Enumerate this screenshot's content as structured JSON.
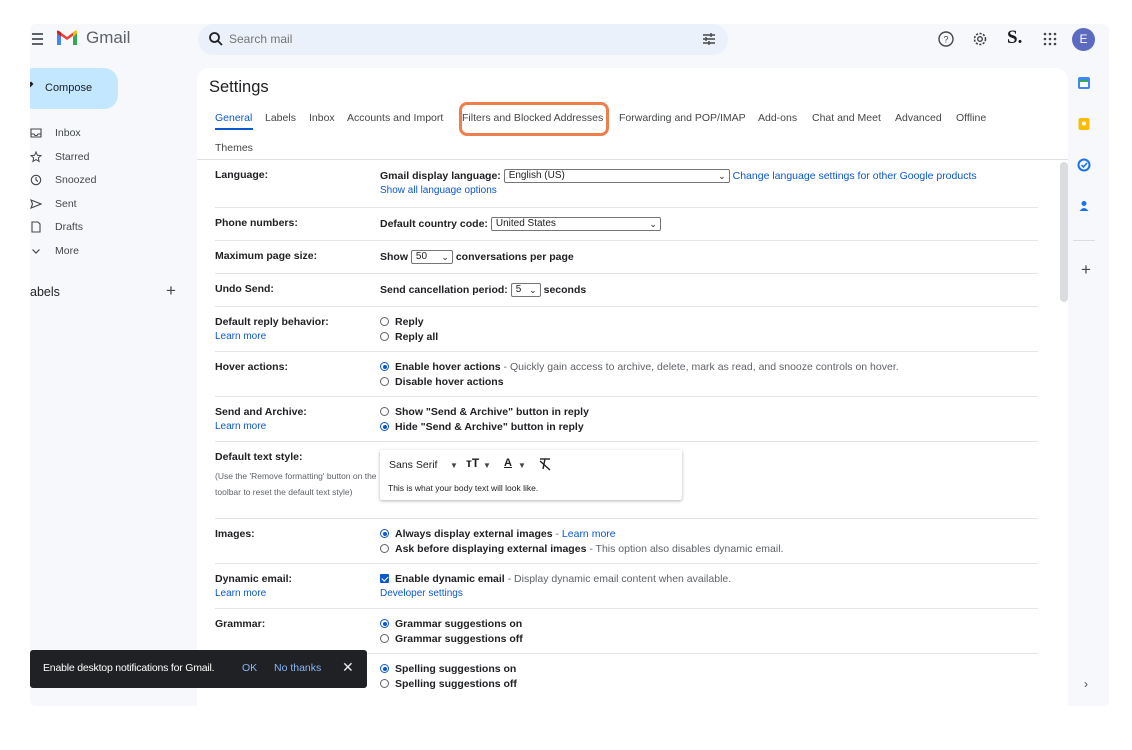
{
  "app": {
    "name": "Gmail",
    "brand_colors": {
      "red": "#ea4335",
      "blue": "#4285f4",
      "green": "#34a853",
      "yellow": "#fbbc04"
    },
    "accent": "#0b57d0"
  },
  "search": {
    "placeholder": "Search mail"
  },
  "header": {
    "avatar_letter": "E",
    "account_mark": "S."
  },
  "nav": {
    "compose_label": "Compose",
    "items": [
      {
        "label": "Inbox",
        "icon": "inbox-icon"
      },
      {
        "label": "Starred",
        "icon": "star-icon"
      },
      {
        "label": "Snoozed",
        "icon": "clock-icon"
      },
      {
        "label": "Sent",
        "icon": "send-icon"
      },
      {
        "label": "Drafts",
        "icon": "draft-icon"
      },
      {
        "label": "More",
        "icon": "chevron-down-icon"
      }
    ],
    "labels_title": "Labels",
    "labels_visible": "abels"
  },
  "settings": {
    "title": "Settings",
    "tabs": [
      {
        "label": "General",
        "active": true
      },
      {
        "label": "Labels"
      },
      {
        "label": "Inbox"
      },
      {
        "label": "Accounts and Import"
      },
      {
        "label": "Filters and Blocked Addresses",
        "highlighted": true
      },
      {
        "label": "Forwarding and POP/IMAP"
      },
      {
        "label": "Add-ons"
      },
      {
        "label": "Chat and Meet"
      },
      {
        "label": "Advanced"
      },
      {
        "label": "Offline"
      },
      {
        "label": "Themes"
      }
    ],
    "rows": {
      "language": {
        "label": "Language:",
        "display_label": "Gmail display language:",
        "display_value": "English (US)",
        "change_link": "Change language settings for other Google products",
        "show_all": "Show all language options"
      },
      "phone": {
        "label": "Phone numbers:",
        "country_label": "Default country code:",
        "country_value": "United States"
      },
      "page_size": {
        "label": "Maximum page size:",
        "prefix": "Show",
        "value": "50",
        "suffix": "conversations per page"
      },
      "undo": {
        "label": "Undo Send:",
        "prefix": "Send cancellation period:",
        "value": "5",
        "suffix": "seconds"
      },
      "reply": {
        "label": "Default reply behavior:",
        "learn_more": "Learn more",
        "options": [
          "Reply",
          "Reply all"
        ],
        "selected": "none"
      },
      "hover": {
        "label": "Hover actions:",
        "enable": "Enable hover actions",
        "enable_desc": " - Quickly gain access to archive, delete, mark as read, and snooze controls on hover.",
        "disable": "Disable hover actions",
        "selected": "Enable hover actions"
      },
      "send_archive": {
        "label": "Send and Archive:",
        "learn_more": "Learn more",
        "show": "Show \"Send & Archive\" button in reply",
        "hide": "Hide \"Send & Archive\" button in reply",
        "selected": "Hide \"Send & Archive\" button in reply"
      },
      "text_style": {
        "label": "Default text style:",
        "note": "(Use the 'Remove formatting' button on the toolbar to reset the default text style)",
        "font": "Sans Serif",
        "sample": "This is what your body text will look like."
      },
      "images": {
        "label": "Images:",
        "always": "Always display external images",
        "always_link": "Learn more",
        "ask": "Ask before displaying external images",
        "ask_desc": " - This option also disables dynamic email.",
        "selected": "Always display external images"
      },
      "dynamic": {
        "label": "Dynamic email:",
        "learn_more": "Learn more",
        "enable": "Enable dynamic email",
        "enable_desc": " - Display dynamic email content when available.",
        "checked": true,
        "dev_link": "Developer settings"
      },
      "grammar": {
        "label": "Grammar:",
        "on": "Grammar suggestions on",
        "off": "Grammar suggestions off",
        "selected": "Grammar suggestions on"
      },
      "spelling": {
        "on": "Spelling suggestions on",
        "off": "Spelling suggestions off",
        "selected": "Spelling suggestions on"
      }
    }
  },
  "toast": {
    "message": "Enable desktop notifications for Gmail.",
    "ok": "OK",
    "no": "No thanks"
  },
  "rail": {
    "icons": [
      "calendar-icon",
      "keep-icon",
      "tasks-icon",
      "contacts-icon"
    ],
    "add": "+"
  }
}
